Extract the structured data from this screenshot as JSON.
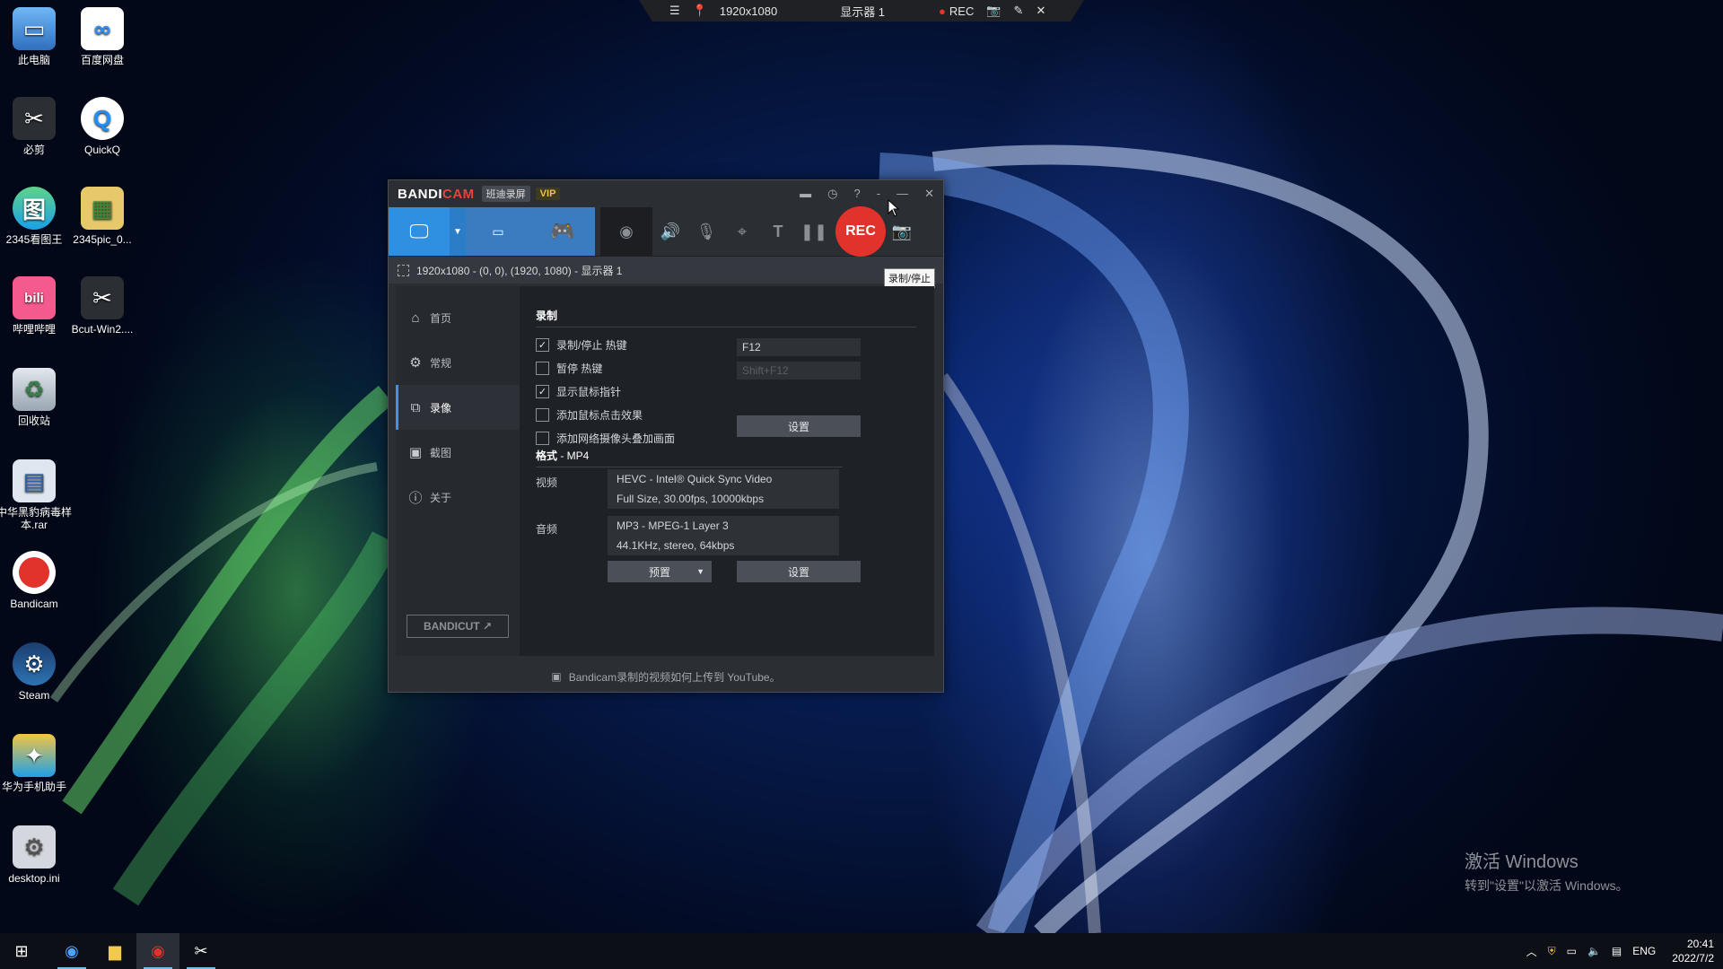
{
  "desktop": {
    "icons": [
      {
        "label": "此电脑",
        "icon": "computer-icon"
      },
      {
        "label": "百度网盘",
        "icon": "baidu-netdisk-icon"
      },
      {
        "label": "必剪",
        "icon": "bijian-icon"
      },
      {
        "label": "QuickQ",
        "icon": "quickq-icon"
      },
      {
        "label": "2345看图王",
        "icon": "image-viewer-icon"
      },
      {
        "label": "2345pic_0...",
        "icon": "image-file-icon"
      },
      {
        "label": "哔哩哔哩",
        "icon": "bilibili-icon"
      },
      {
        "label": "Bcut-Win2....",
        "icon": "bcut-icon"
      },
      {
        "label": "回收站",
        "icon": "recycle-bin-icon"
      },
      {
        "label": "中华黑豹病毒样本.rar",
        "icon": "rar-archive-icon"
      },
      {
        "label": "Bandicam",
        "icon": "bandicam-icon"
      },
      {
        "label": "Steam",
        "icon": "steam-icon"
      },
      {
        "label": "华为手机助手",
        "icon": "huawei-assistant-icon"
      },
      {
        "label": "desktop.ini",
        "icon": "settings-file-icon"
      }
    ]
  },
  "rec_bar": {
    "resolution": "1920x1080",
    "display": "显示器 1",
    "rec_label": "REC"
  },
  "bandicam": {
    "brand_main": "BANDI",
    "brand_accent": "CAM",
    "brand_sub": "班迪录屏",
    "vip": "VIP",
    "rec_button": "REC",
    "tooltip": "录制/停止",
    "area_text": "1920x1080 - (0, 0), (1920, 1080) - 显示器 1",
    "nav": [
      {
        "label": "首页",
        "icon": "home-icon"
      },
      {
        "label": "常规",
        "icon": "gear-icon"
      },
      {
        "label": "录像",
        "icon": "video-record-icon"
      },
      {
        "label": "截图",
        "icon": "screenshot-icon"
      },
      {
        "label": "关于",
        "icon": "info-icon"
      }
    ],
    "active_nav": "录像",
    "bandicut": "BANDICUT ↗",
    "record_section": {
      "title": "录制",
      "options": [
        {
          "label": "录制/停止 热键",
          "checked": true
        },
        {
          "label": "暂停 热键",
          "checked": false
        },
        {
          "label": "显示鼠标指针",
          "checked": true
        },
        {
          "label": "添加鼠标点击效果",
          "checked": false
        },
        {
          "label": "添加网络摄像头叠加画面",
          "checked": false
        }
      ],
      "hotkey_record": "F12",
      "hotkey_pause": "Shift+F12",
      "settings_button": "设置"
    },
    "format_section": {
      "title_prefix": "格式",
      "title_suffix": " - MP4",
      "video_label": "视频",
      "video_line1": "HEVC - Intel® Quick Sync Video",
      "video_line2": "Full Size, 30.00fps, 10000kbps",
      "audio_label": "音频",
      "audio_line1": "MP3 - MPEG-1 Layer 3",
      "audio_line2": "44.1KHz, stereo, 64kbps",
      "preset_button": "预置",
      "settings_button": "设置"
    },
    "status_text": "Bandicam录制的视频如何上传到 YouTube。"
  },
  "watermark": {
    "line1": "激活 Windows",
    "line2": "转到\"设置\"以激活 Windows。"
  },
  "taskbar": {
    "ime": "ENG",
    "time": "20:41",
    "date": "2022/7/2"
  }
}
